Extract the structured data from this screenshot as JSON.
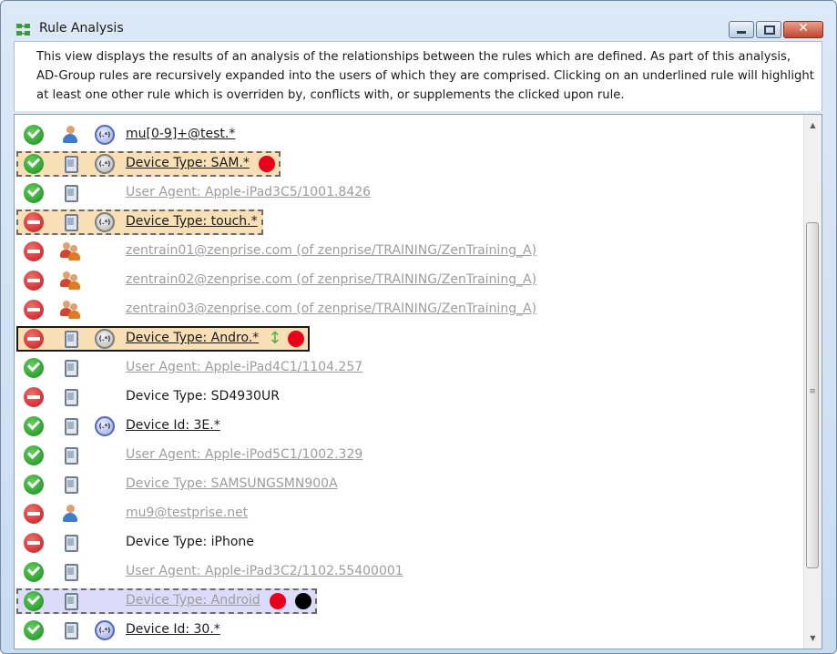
{
  "window": {
    "title": "Rule Analysis",
    "controls": {
      "minimize": "minimize",
      "maximize": "maximize",
      "close": "✕"
    }
  },
  "description": "This view displays the results of an analysis of the relationships between the rules which are defined. As part of this analysis, AD-Group rules are recursively expanded into the users of which they are comprised. Clicking on an underlined rule will highlight at least one other rule which is overriden by, conflicts with, or supplements the clicked upon rule.",
  "rules": [
    {
      "status": "allow",
      "type": "user",
      "regex": "blue",
      "label": "mu[0-9]+@test.*",
      "style": "underlined",
      "highlight": "none",
      "markers": []
    },
    {
      "status": "allow",
      "type": "device",
      "regex": "gray",
      "label": "Device Type: SAM.*",
      "style": "underlined",
      "highlight": "orange-dashed",
      "markers": [
        "red-dot"
      ]
    },
    {
      "status": "allow",
      "type": "device",
      "regex": "none",
      "label": "User Agent: Apple-iPad3C5/1001.8426",
      "style": "underlined-gray",
      "highlight": "none",
      "markers": []
    },
    {
      "status": "deny",
      "type": "device",
      "regex": "gray",
      "label": "Device Type: touch.*",
      "style": "underlined",
      "highlight": "orange-dashed",
      "markers": []
    },
    {
      "status": "deny",
      "type": "group",
      "regex": "none",
      "label": "zentrain01@zenprise.com (of zenprise/TRAINING/ZenTraining_A)",
      "style": "underlined-gray",
      "highlight": "none",
      "markers": []
    },
    {
      "status": "deny",
      "type": "group",
      "regex": "none",
      "label": "zentrain02@zenprise.com (of zenprise/TRAINING/ZenTraining_A)",
      "style": "underlined-gray",
      "highlight": "none",
      "markers": []
    },
    {
      "status": "deny",
      "type": "group",
      "regex": "none",
      "label": "zentrain03@zenprise.com (of zenprise/TRAINING/ZenTraining_A)",
      "style": "underlined-gray",
      "highlight": "none",
      "markers": []
    },
    {
      "status": "deny",
      "type": "device",
      "regex": "gray",
      "label": "Device Type: Andro.*",
      "style": "underlined",
      "highlight": "orange-solid",
      "markers": [
        "arrows",
        "red-dot"
      ]
    },
    {
      "status": "allow",
      "type": "device",
      "regex": "none",
      "label": "User Agent: Apple-iPad4C1/1104.257",
      "style": "underlined-gray",
      "highlight": "none",
      "markers": []
    },
    {
      "status": "deny",
      "type": "device",
      "regex": "none",
      "label": "Device Type: SD4930UR",
      "style": "plain",
      "highlight": "none",
      "markers": []
    },
    {
      "status": "allow",
      "type": "device",
      "regex": "blue",
      "label": "Device Id: 3E.*",
      "style": "underlined",
      "highlight": "none",
      "markers": []
    },
    {
      "status": "allow",
      "type": "device",
      "regex": "none",
      "label": "User Agent: Apple-iPod5C1/1002.329",
      "style": "underlined-gray",
      "highlight": "none",
      "markers": []
    },
    {
      "status": "allow",
      "type": "device",
      "regex": "none",
      "label": "Device Type: SAMSUNGSMN900A",
      "style": "underlined-gray",
      "highlight": "none",
      "markers": []
    },
    {
      "status": "deny",
      "type": "user",
      "regex": "none",
      "label": "mu9@testprise.net",
      "style": "underlined-gray",
      "highlight": "none",
      "markers": []
    },
    {
      "status": "deny",
      "type": "device",
      "regex": "none",
      "label": "Device Type: iPhone",
      "style": "plain",
      "highlight": "none",
      "markers": []
    },
    {
      "status": "allow",
      "type": "device",
      "regex": "none",
      "label": "User Agent: Apple-iPad3C2/1102.55400001",
      "style": "underlined-gray",
      "highlight": "none",
      "markers": []
    },
    {
      "status": "allow",
      "type": "device",
      "regex": "none",
      "label": "Device Type: Android",
      "style": "underlined-gray",
      "highlight": "purple-dashed",
      "markers": [
        "red-dot",
        "black-dot"
      ]
    },
    {
      "status": "allow",
      "type": "device",
      "regex": "blue",
      "label": "Device Id: 30.*",
      "style": "underlined",
      "highlight": "none",
      "markers": []
    }
  ],
  "colors": {
    "allow": "#1d8a1d",
    "deny": "#c01818",
    "highlight_orange": "#f9dfb6",
    "highlight_purple": "#dcdcfa",
    "marker_red": "#e8001a"
  },
  "icons": {
    "allow": "check-circle-icon",
    "deny": "no-entry-icon",
    "user": "user-icon",
    "group": "user-group-icon",
    "device": "device-icon",
    "regex": "regex-icon"
  }
}
